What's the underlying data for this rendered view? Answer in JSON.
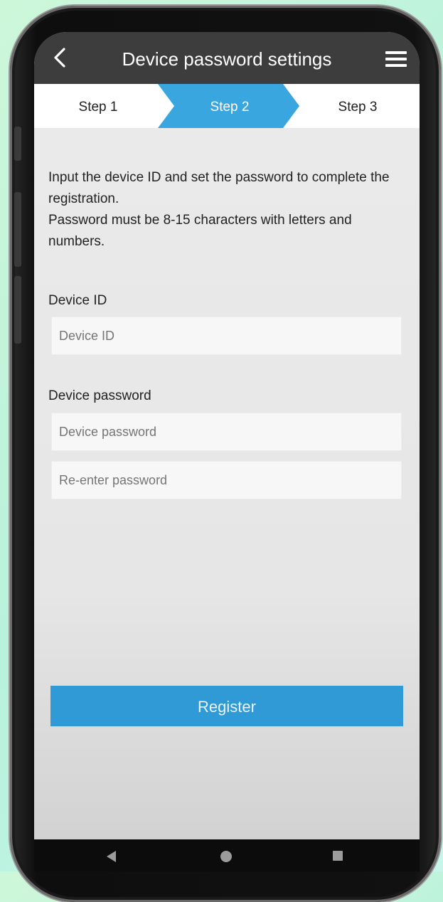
{
  "header": {
    "title": "Device password settings",
    "back_icon": "chevron-left-icon",
    "menu_icon": "hamburger-menu-icon"
  },
  "steps": {
    "items": [
      "Step 1",
      "Step 2",
      "Step 3"
    ],
    "active_index": 1,
    "active_color": "#3aa6e0"
  },
  "instructions": {
    "line1": "Input the device ID and set the password to complete the registration.",
    "line2": "Password must be 8-15 characters with letters and numbers."
  },
  "device_id": {
    "label": "Device ID",
    "placeholder": "Device ID",
    "value": ""
  },
  "device_password": {
    "label": "Device password",
    "placeholder": "Device password",
    "confirm_placeholder": "Re-enter password",
    "value": "",
    "confirm_value": ""
  },
  "register_button": {
    "label": "Register",
    "color": "#2f9ad6"
  },
  "colors": {
    "header_bg": "#3d3d3d",
    "background": "#eaeaea"
  },
  "system_nav": {
    "back_icon": "triangle-back-icon",
    "home_icon": "circle-home-icon",
    "recent_icon": "square-recent-apps-icon"
  }
}
